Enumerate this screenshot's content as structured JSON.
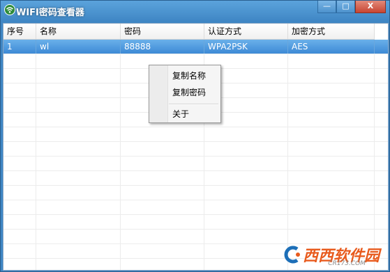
{
  "window": {
    "title": "WIFI密码查看器"
  },
  "title_buttons": {
    "minimize": "—",
    "maximize": "□",
    "close": "X"
  },
  "table": {
    "columns": [
      "序号",
      "名称",
      "密码",
      "认证方式",
      "加密方式"
    ],
    "rows": [
      {
        "index": "1",
        "name": "wl",
        "password": "88888",
        "auth": "WPA2PSK",
        "encryption": "AES"
      }
    ]
  },
  "context_menu": {
    "copy_name": "复制名称",
    "copy_password": "复制密码",
    "about": "关于"
  },
  "watermark": {
    "text": "西西软件园",
    "sub": "CR173.COM"
  },
  "colors": {
    "title_bar": "#3f86c4",
    "selection": "#3d8ad6",
    "watermark": "#e85b1e"
  }
}
